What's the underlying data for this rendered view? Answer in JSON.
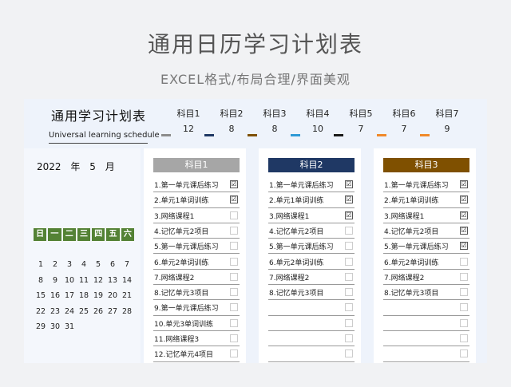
{
  "title": "通用日历学习计划表",
  "subtitle": "EXCEL格式/布局合理/界面美观",
  "sheet": {
    "title": "通用学习计划表",
    "subtitle": "Universal learning schedule",
    "subjects": [
      {
        "name": "科目1",
        "count": "12",
        "color": "#8c8c8c"
      },
      {
        "name": "科目2",
        "count": "8",
        "color": "#1f3864"
      },
      {
        "name": "科目3",
        "count": "8",
        "color": "#7f5000"
      },
      {
        "name": "科目4",
        "count": "10",
        "color": "#2e9ad6"
      },
      {
        "name": "科目5",
        "count": "7",
        "color": "#1a1a1a"
      },
      {
        "name": "科目6",
        "count": "7",
        "color": "#f0892a"
      },
      {
        "name": "科目7",
        "count": "9",
        "color": "#f0892a"
      }
    ]
  },
  "calendar": {
    "year": "2022",
    "year_label": "年",
    "month": "5",
    "month_label": "月",
    "weekdays": [
      "日",
      "一",
      "二",
      "三",
      "四",
      "五",
      "六"
    ],
    "days": [
      "1",
      "2",
      "3",
      "4",
      "5",
      "6",
      "7",
      "8",
      "9",
      "10",
      "11",
      "12",
      "13",
      "14",
      "15",
      "16",
      "17",
      "18",
      "19",
      "20",
      "21",
      "22",
      "23",
      "24",
      "25",
      "26",
      "27",
      "28",
      "29",
      "30",
      "31"
    ]
  },
  "columns": [
    {
      "header": "科目1",
      "color": "#a6a6a6",
      "tasks": [
        {
          "text": "1.第一单元课后练习",
          "checked": true
        },
        {
          "text": "2.单元1单词训练",
          "checked": true
        },
        {
          "text": "3.网络课程1",
          "checked": false
        },
        {
          "text": "4.记忆单元2项目",
          "checked": false
        },
        {
          "text": "5.第一单元课后练习",
          "checked": false
        },
        {
          "text": "6.单元2单词训练",
          "checked": false
        },
        {
          "text": "7.网络课程2",
          "checked": false
        },
        {
          "text": "8.记忆单元3项目",
          "checked": false
        },
        {
          "text": "9.第一单元课后练习",
          "checked": false
        },
        {
          "text": "10.单元3单词训练",
          "checked": false
        },
        {
          "text": "11.网络课程3",
          "checked": false
        },
        {
          "text": "12.记忆单元4项目",
          "checked": false
        }
      ]
    },
    {
      "header": "科目2",
      "color": "#1f3864",
      "tasks": [
        {
          "text": "1.第一单元课后练习",
          "checked": true
        },
        {
          "text": "2.单元1单词训练",
          "checked": true
        },
        {
          "text": "3.网络课程1",
          "checked": true
        },
        {
          "text": "4.记忆单元2项目",
          "checked": false
        },
        {
          "text": "5.第一单元课后练习",
          "checked": false
        },
        {
          "text": "6.单元2单词训练",
          "checked": false
        },
        {
          "text": "7.网络课程2",
          "checked": false
        },
        {
          "text": "8.记忆单元3项目",
          "checked": false
        },
        {
          "text": "",
          "checked": false
        },
        {
          "text": "",
          "checked": false
        },
        {
          "text": "",
          "checked": false
        },
        {
          "text": "",
          "checked": false
        }
      ]
    },
    {
      "header": "科目3",
      "color": "#7f5000",
      "tasks": [
        {
          "text": "1.第一单元课后练习",
          "checked": true
        },
        {
          "text": "2.单元1单词训练",
          "checked": true
        },
        {
          "text": "3.网络课程1",
          "checked": true
        },
        {
          "text": "4.记忆单元2项目",
          "checked": true
        },
        {
          "text": "5.第一单元课后练习",
          "checked": true
        },
        {
          "text": "6.单元2单词训练",
          "checked": false
        },
        {
          "text": "7.网络课程2",
          "checked": false
        },
        {
          "text": "8.记忆单元3项目",
          "checked": false
        },
        {
          "text": "",
          "checked": false
        },
        {
          "text": "",
          "checked": false
        },
        {
          "text": "",
          "checked": false
        },
        {
          "text": "",
          "checked": false
        }
      ]
    }
  ]
}
